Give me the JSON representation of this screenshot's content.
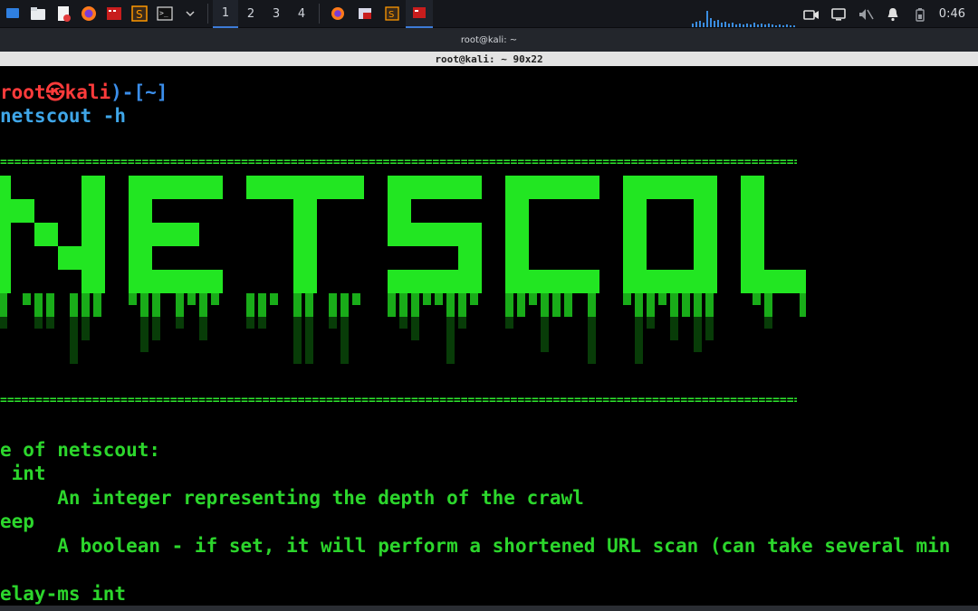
{
  "taskbar": {
    "workspaces": [
      "1",
      "2",
      "3",
      "4"
    ],
    "active_workspace": "1",
    "clock": "0:46",
    "apps": [
      "show-desktop-icon",
      "file-manager-icon",
      "text-editor-icon",
      "firefox-icon",
      "metasploit-icon",
      "sublime-icon",
      "terminal-icon"
    ]
  },
  "window": {
    "title": "root@kali: ~",
    "terminal_title": "root@kali: ~ 90x22"
  },
  "terminal": {
    "prompt_user": "root",
    "prompt_at": "㉿",
    "prompt_host": "kali",
    "prompt_dir": "~",
    "command": "netscout -h",
    "banner_text": "NETSCOUT",
    "equals_rule": "==============================================================================================================================",
    "usage_lines": [
      "e of netscout:",
      " int",
      "     An integer representing the depth of the crawl",
      "eep",
      "     A boolean - if set, it will perform a shortened URL scan (can take several min",
      "",
      "elay-ms int"
    ]
  },
  "colors": {
    "prompt_red": "#ff3b3b",
    "prompt_blue": "#3b8eea",
    "terminal_green": "#2cd62c",
    "banner_bright": "#22e622",
    "banner_dark": "#0f6e0f"
  }
}
